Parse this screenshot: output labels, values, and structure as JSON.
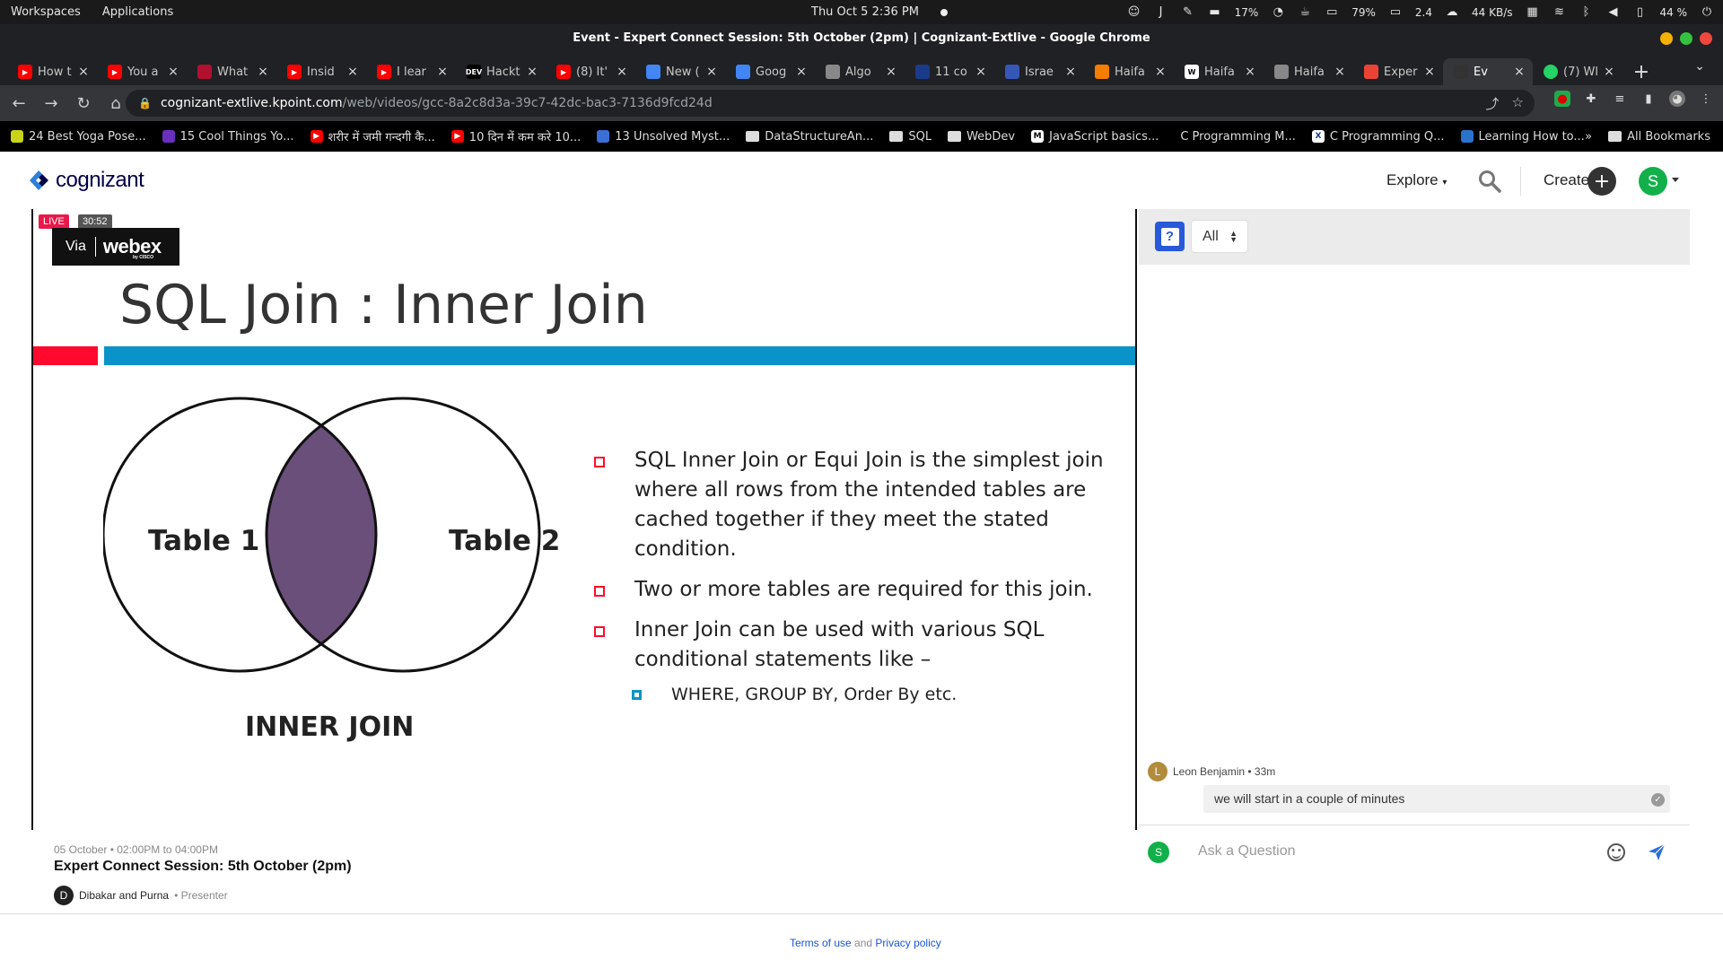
{
  "os": {
    "menu": [
      "Workspaces",
      "Applications"
    ],
    "datetime": "Thu Oct 5   2:36 PM",
    "tray": {
      "cpu": "17%",
      "battery_pct": "79%",
      "load": "2.4",
      "net": "44 KB/s",
      "volume_pct": "44 %"
    }
  },
  "window": {
    "title": "Event - Expert Connect Session: 5th October (2pm) | Cognizant-Extlive - Google Chrome"
  },
  "tabs": [
    {
      "label": "How t",
      "icon": "youtube-icon",
      "color": "#ff0000"
    },
    {
      "label": "You a",
      "icon": "youtube-icon",
      "color": "#ff0000"
    },
    {
      "label": "What",
      "icon": "hl-icon",
      "color": "#b2102f"
    },
    {
      "label": "Insid",
      "icon": "youtube-icon",
      "color": "#ff0000"
    },
    {
      "label": "I lear",
      "icon": "youtube-icon",
      "color": "#ff0000"
    },
    {
      "label": "Hackt",
      "icon": "dev-icon",
      "color": "#000000"
    },
    {
      "label": "(8) It'",
      "icon": "youtube-icon",
      "color": "#ff0000"
    },
    {
      "label": "New (",
      "icon": "google-cloud-icon",
      "color": "#4285f4"
    },
    {
      "label": "Goog",
      "icon": "google-cloud-icon",
      "color": "#4285f4"
    },
    {
      "label": "Algo",
      "icon": "globe-icon",
      "color": "#888888"
    },
    {
      "label": "11 co",
      "icon": "r-icon",
      "color": "#1a3b8a"
    },
    {
      "label": "Israe",
      "icon": "israel-icon",
      "color": "#3557b8"
    },
    {
      "label": "Haifa",
      "icon": "blogger-icon",
      "color": "#f57d00"
    },
    {
      "label": "Haifa",
      "icon": "wikipedia-icon",
      "color": "#ffffff"
    },
    {
      "label": "Haifa",
      "icon": "globe-icon",
      "color": "#888888"
    },
    {
      "label": "Exper",
      "icon": "gmail-icon",
      "color": "#ea4335"
    },
    {
      "label": "Ev",
      "icon": "kpoint-icon",
      "color": "#333333",
      "active": true
    },
    {
      "label": "(7) Wl",
      "icon": "whatsapp-icon",
      "color": "#25d366"
    }
  ],
  "address": {
    "host": "cognizant-extlive.kpoint.com",
    "path": "/web/videos/gcc-8a2c8d3a-39c7-42dc-bac3-7136d9fcd24d"
  },
  "bookmarks": [
    {
      "label": "24 Best Yoga Pose...",
      "icon": "yoga-icon",
      "color": "#c9d31a"
    },
    {
      "label": "15 Cool Things Yo...",
      "icon": "purple-icon",
      "color": "#6b2fbf"
    },
    {
      "label": "शरीर में जमी गन्दगी कै...",
      "icon": "youtube-icon",
      "color": "#ff0000"
    },
    {
      "label": "10 दिन में कम करे 10...",
      "icon": "youtube-icon",
      "color": "#ff0000"
    },
    {
      "label": "13 Unsolved Myst...",
      "icon": "hindi-icon",
      "color": "#3b6fd6"
    },
    {
      "label": "DataStructureAn...",
      "icon": "folder-icon"
    },
    {
      "label": "SQL",
      "icon": "folder-icon"
    },
    {
      "label": "WebDev",
      "icon": "folder-icon"
    },
    {
      "label": "JavaScript basics...",
      "icon": "medium-icon",
      "color": "#ffffff"
    },
    {
      "label": "C Programming M...",
      "icon": "blank-icon"
    },
    {
      "label": "C Programming Q...",
      "icon": "x-icon",
      "color": "#ffffff"
    },
    {
      "label": "Learning How to...",
      "icon": "coursera-icon",
      "color": "#2a73cc"
    }
  ],
  "bookmarks_more": "»",
  "all_bookmarks": "All Bookmarks",
  "site": {
    "logo": "cognizant",
    "explore": "Explore",
    "create": "Create",
    "avatar_initial": "S",
    "brand_color": "#000048",
    "avatar_color": "#12b04a"
  },
  "video": {
    "live": "LIVE",
    "elapsed": "30:52",
    "via": "Via",
    "webex": "webex",
    "cisco": "by CISCO"
  },
  "slide": {
    "title": "SQL Join : Inner Join",
    "table1": "Table 1",
    "table2": "Table 2",
    "caption": "INNER JOIN",
    "bullets": [
      "SQL Inner Join or Equi Join is the simplest join where all rows from the intended tables are cached together if they meet the stated condition.",
      "Two or more tables are required for this join.",
      "Inner Join can be used with various SQL conditional statements like –"
    ],
    "sub_bullet": "WHERE, GROUP BY, Order By etc.",
    "accent_red": "#ff0a2e",
    "accent_blue": "#0a93c8",
    "intersection_color": "#6a4f7a"
  },
  "event": {
    "when": "05 October • 02:00PM to 04:00PM",
    "title": "Expert Connect Session: 5th October (2pm)",
    "presenter_initial": "D",
    "presenter": "Dibakar and Purna",
    "role": "• Presenter"
  },
  "qa": {
    "filter": "All",
    "message": {
      "author_initial": "L",
      "author": "Leon Benjamin • 33m",
      "text": "we will start in a couple of minutes"
    },
    "user_initial": "S",
    "placeholder": "Ask a Question"
  },
  "footer": {
    "terms": "Terms of use",
    "and": " and ",
    "privacy": "Privacy policy"
  }
}
